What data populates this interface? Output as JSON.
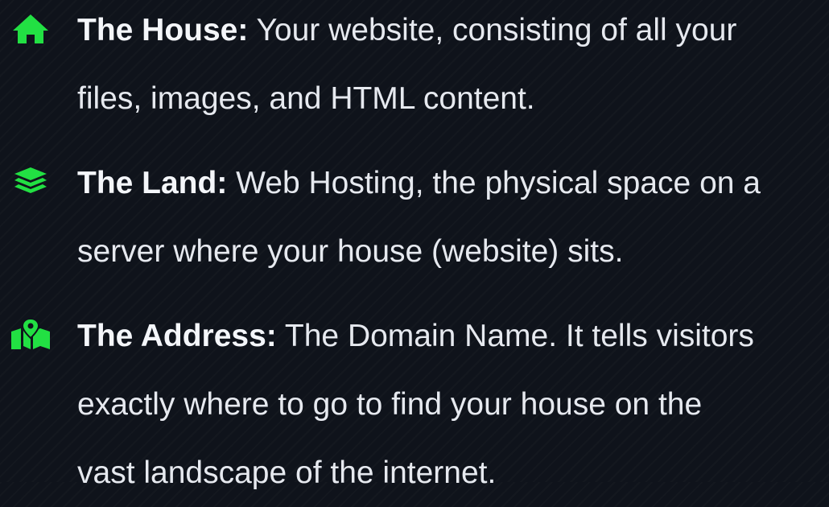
{
  "accent_color": "#22e043",
  "items": [
    {
      "icon": "home-icon",
      "term": "The House:",
      "lines": [
        " Your website, consisting of all your",
        "files, images, and HTML content."
      ]
    },
    {
      "icon": "layers-icon",
      "term": "The Land:",
      "lines": [
        " Web Hosting, the physical space on a",
        "server where your house (website) sits."
      ]
    },
    {
      "icon": "map-location-icon",
      "term": "The Address:",
      "lines": [
        " The Domain Name. It tells visitors",
        "exactly where to go to find your house on the",
        "vast landscape of the internet."
      ]
    }
  ]
}
